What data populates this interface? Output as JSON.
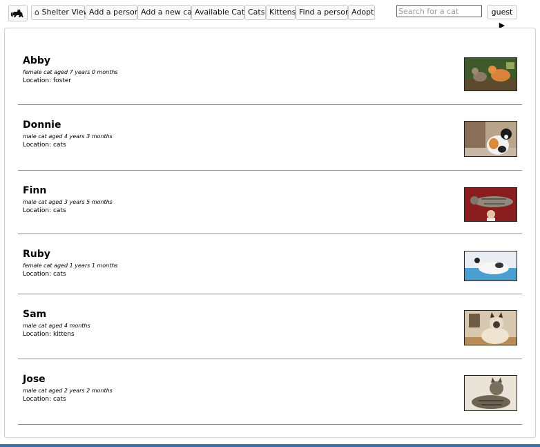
{
  "nav": {
    "logo_icon": "black-cat-icon",
    "home_label": "⌂ Shelter View",
    "add_person": "Add a person",
    "add_cat": "Add a new cat",
    "available_cats": "Available Cats",
    "cats": "Cats",
    "kittens": "Kittens",
    "find_person": "Find a person",
    "adopt": "Adopt",
    "search_placeholder": "Search for a cat",
    "user_label": "guest ▶"
  },
  "cats": [
    {
      "name": "Abby",
      "description": "female cat aged 7 years 0 months",
      "location": "Location: foster",
      "photo": "orange-and-tabby-cats-photo"
    },
    {
      "name": "Donnie",
      "description": "male cat aged 4 years 3 months",
      "location": "Location: cats",
      "photo": "calico-cat-photo"
    },
    {
      "name": "Finn",
      "description": "male cat aged 3 years 5 months",
      "location": "Location: cats",
      "photo": "tabby-cat-held-up-photo"
    },
    {
      "name": "Ruby",
      "description": "female cat aged 1 years 1 months",
      "location": "Location: cats",
      "photo": "white-cat-lying-photo"
    },
    {
      "name": "Sam",
      "description": "male cat aged 4 months",
      "location": "Location: kittens",
      "photo": "siamese-cat-photo"
    },
    {
      "name": "Jose",
      "description": "male cat aged 2 years 2 months",
      "location": "Location: cats",
      "photo": "tabby-cat-lying-photo"
    }
  ],
  "colors": {
    "bottom_bar": "#3d6aa8",
    "divider": "#8a8a8a"
  }
}
